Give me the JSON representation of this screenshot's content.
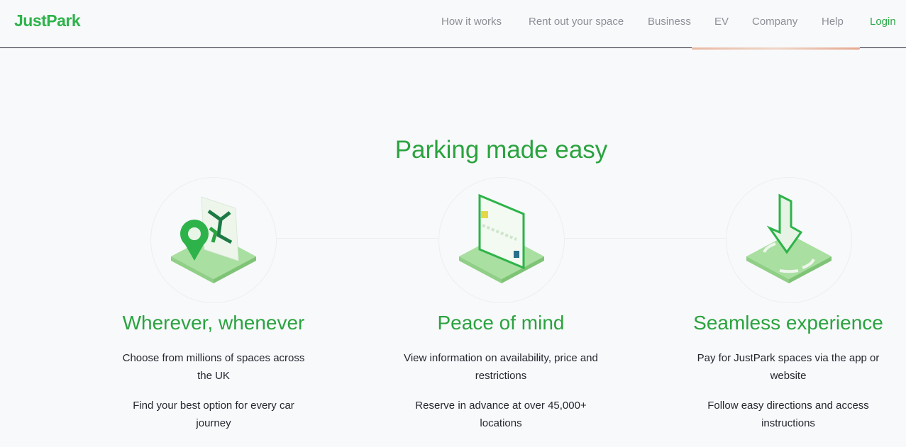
{
  "header": {
    "logo": "JustPark",
    "nav": [
      {
        "label": "How it works"
      },
      {
        "label": "Rent out your space"
      },
      {
        "label": "Business"
      },
      {
        "label": "EV"
      },
      {
        "label": "Company"
      },
      {
        "label": "Help"
      },
      {
        "label": "Login"
      }
    ]
  },
  "main": {
    "headline": "Parking made easy",
    "features": [
      {
        "icon": "map-pin-icon",
        "title": "Wherever, whenever",
        "lines": [
          "Choose from millions of spaces across the UK",
          "Find your best option for every car journey"
        ]
      },
      {
        "icon": "credit-card-icon",
        "title": "Peace of mind",
        "lines": [
          "View information on availability, price and restrictions",
          "Reserve in advance at over 45,000+ locations"
        ]
      },
      {
        "icon": "download-arrow-icon",
        "title": "Seamless experience",
        "lines": [
          "Pay for JustPark spaces via the app or website",
          "Follow easy directions and access instructions"
        ]
      }
    ]
  },
  "colors": {
    "brand_green": "#2db34a",
    "nav_grey": "#8c8f96",
    "text_dark": "#24272e"
  }
}
